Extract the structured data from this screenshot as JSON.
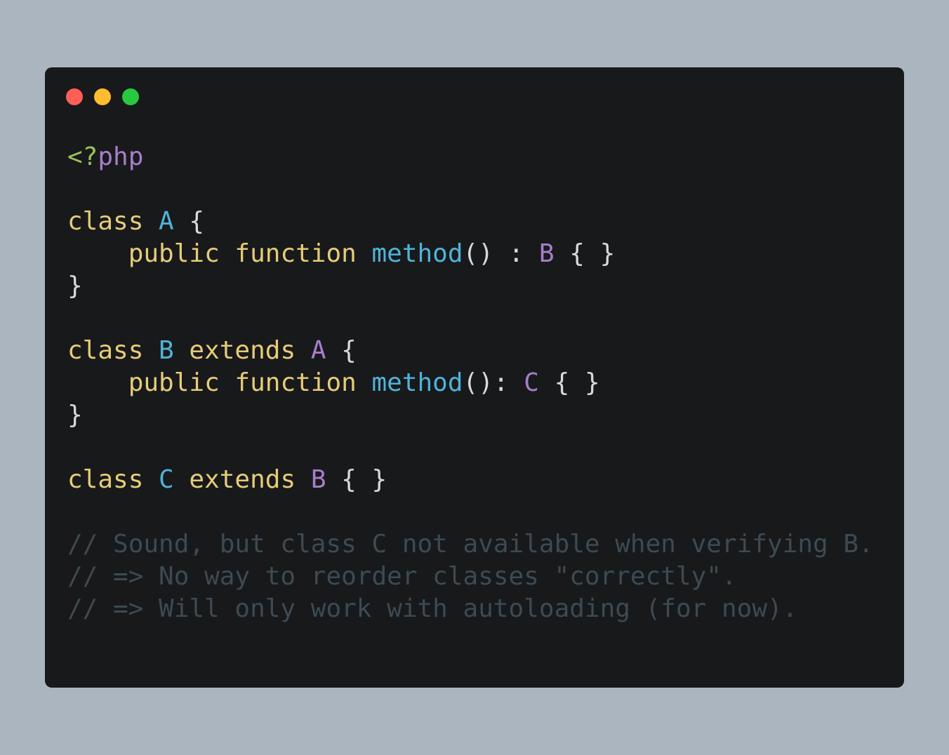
{
  "window": {
    "controls": [
      "close",
      "minimize",
      "maximize"
    ],
    "colors": {
      "close": "#ff5f57",
      "minimize": "#febc2e",
      "maximize": "#28c840",
      "background": "#18191b"
    }
  },
  "code": {
    "language": "php",
    "lines": [
      [
        {
          "t": "tag",
          "v": "<?"
        },
        {
          "t": "php",
          "v": "php"
        }
      ],
      [],
      [
        {
          "t": "kw",
          "v": "class "
        },
        {
          "t": "cls",
          "v": "A"
        },
        {
          "t": "plain",
          "v": " {"
        }
      ],
      [
        {
          "t": "plain",
          "v": "    "
        },
        {
          "t": "kw",
          "v": "public function "
        },
        {
          "t": "fn",
          "v": "method"
        },
        {
          "t": "plain",
          "v": "() : "
        },
        {
          "t": "type",
          "v": "B"
        },
        {
          "t": "plain",
          "v": " { }"
        }
      ],
      [
        {
          "t": "plain",
          "v": "}"
        }
      ],
      [],
      [
        {
          "t": "kw",
          "v": "class "
        },
        {
          "t": "cls",
          "v": "B"
        },
        {
          "t": "kw",
          "v": " extends "
        },
        {
          "t": "type",
          "v": "A"
        },
        {
          "t": "plain",
          "v": " {"
        }
      ],
      [
        {
          "t": "plain",
          "v": "    "
        },
        {
          "t": "kw",
          "v": "public function "
        },
        {
          "t": "fn",
          "v": "method"
        },
        {
          "t": "plain",
          "v": "(): "
        },
        {
          "t": "type",
          "v": "C"
        },
        {
          "t": "plain",
          "v": " { }"
        }
      ],
      [
        {
          "t": "plain",
          "v": "}"
        }
      ],
      [],
      [
        {
          "t": "kw",
          "v": "class "
        },
        {
          "t": "cls",
          "v": "C"
        },
        {
          "t": "kw",
          "v": " extends "
        },
        {
          "t": "type",
          "v": "B"
        },
        {
          "t": "plain",
          "v": " { }"
        }
      ],
      [],
      [
        {
          "t": "comment",
          "v": "// Sound, but class C not available when verifying B."
        }
      ],
      [
        {
          "t": "comment",
          "v": "// => No way to reorder classes \"correctly\"."
        }
      ],
      [
        {
          "t": "comment",
          "v": "// => Will only work with autoloading (for now)."
        }
      ]
    ]
  }
}
